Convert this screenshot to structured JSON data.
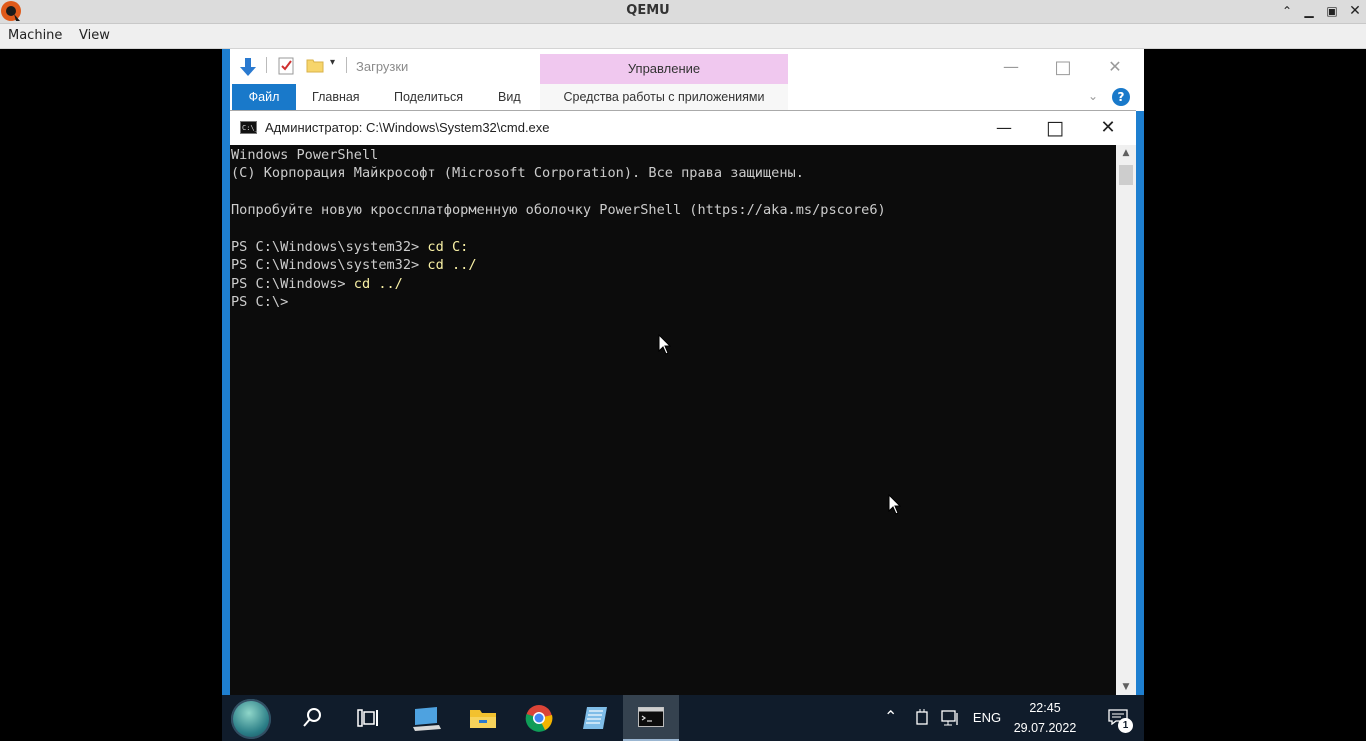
{
  "qemu": {
    "title": "QEMU",
    "menu": [
      "Machine",
      "View"
    ],
    "controls": [
      "restore-icon",
      "minimize-icon",
      "maximize-icon",
      "close-icon"
    ]
  },
  "explorer": {
    "path_label": "Загрузки",
    "context_group_label": "Управление",
    "tabs": [
      "Файл",
      "Главная",
      "Поделиться",
      "Вид"
    ],
    "context_tab": "Средства работы с приложениями",
    "accent_color": "#1979ca",
    "context_color": "#f0c8ef"
  },
  "cmd": {
    "title": "Администратор: C:\\Windows\\System32\\cmd.exe",
    "icon_text": "C:\\_",
    "console_lines": [
      {
        "text": "Windows PowerShell",
        "cmd": ""
      },
      {
        "text": "(C) Корпорация Майкрософт (Microsoft Corporation). Все права защищены.",
        "cmd": ""
      },
      {
        "text": "",
        "cmd": ""
      },
      {
        "text": "Попробуйте новую кроссплатформенную оболочку PowerShell (https://aka.ms/pscore6)",
        "cmd": ""
      },
      {
        "text": "",
        "cmd": ""
      },
      {
        "text": "PS C:\\Windows\\system32> ",
        "cmd": "cd C:"
      },
      {
        "text": "PS C:\\Windows\\system32> ",
        "cmd": "cd ../"
      },
      {
        "text": "PS C:\\Windows> ",
        "cmd": "cd ../"
      },
      {
        "text": "PS C:\\> ",
        "cmd": ""
      }
    ],
    "background": "#0c0c0c",
    "text_color": "#cccccc",
    "command_color": "#f9f1a5"
  },
  "taskbar": {
    "apps": [
      "start-orb",
      "search-icon",
      "task-view-icon",
      "server-manager-icon",
      "file-explorer-icon",
      "chrome-icon",
      "notepad-icon",
      "cmd-icon"
    ],
    "active_app": "cmd-icon",
    "language": "ENG",
    "time": "22:45",
    "date": "29.07.2022",
    "notification_count": "1"
  }
}
